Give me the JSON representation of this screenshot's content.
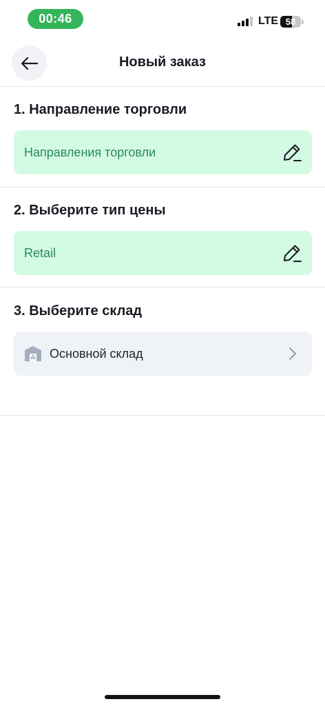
{
  "status_bar": {
    "time": "00:46",
    "network": "LTE",
    "battery": "58",
    "battery_level_percent": 58,
    "signal_bars_active": 3,
    "signal_bars_total": 4,
    "time_pill_color": "#34b55a"
  },
  "header": {
    "title": "Новый заказ",
    "back_icon": "arrow-left-icon"
  },
  "sections": [
    {
      "title": "1. Направление торговли",
      "value": "Направления торговли",
      "icon": "pencil-icon"
    },
    {
      "title": "2. Выберите тип цены",
      "value": "Retail",
      "icon": "pencil-icon"
    },
    {
      "title": "3. Выберите склад",
      "value": "Основной склад",
      "leading_icon": "warehouse-icon",
      "trailing_icon": "chevron-right-icon"
    }
  ],
  "colors": {
    "accent_bg": "#d3fae3",
    "accent_text": "#2a8a5e",
    "neutral_bg": "#eff2f6",
    "divider": "#e4e6ea"
  }
}
